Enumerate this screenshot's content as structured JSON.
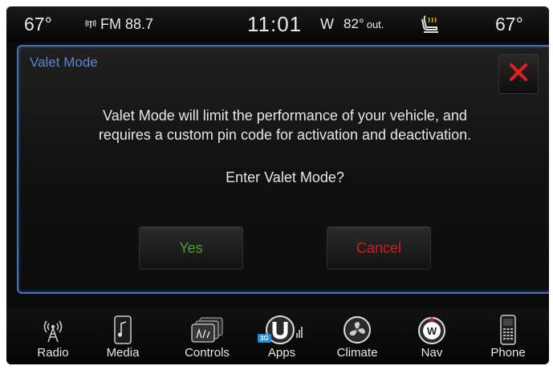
{
  "status_bar": {
    "temp_left": "67°",
    "radio": "FM 88.7",
    "time": "11:01",
    "compass": "W",
    "outside_temp": "82°",
    "outside_label": "out.",
    "temp_right": "67°",
    "icons": [
      "antenna-icon",
      "heated-seat-icon"
    ]
  },
  "dialog": {
    "title": "Valet Mode",
    "message_line1": "Valet Mode will limit the performance of your vehicle, and",
    "message_line2": "requires a custom pin code for activation and deactivation.",
    "question": "Enter Valet Mode?",
    "yes_label": "Yes",
    "cancel_label": "Cancel",
    "close_icon": "close-icon",
    "accent_color": "#4a70b8",
    "yes_color": "#4aa232",
    "cancel_color": "#d21f1f"
  },
  "nav": {
    "radio": "Radio",
    "media": "Media",
    "controls": "Controls",
    "apps": "Apps",
    "apps_badge": "3G",
    "climate": "Climate",
    "nav": "Nav",
    "phone": "Phone"
  }
}
